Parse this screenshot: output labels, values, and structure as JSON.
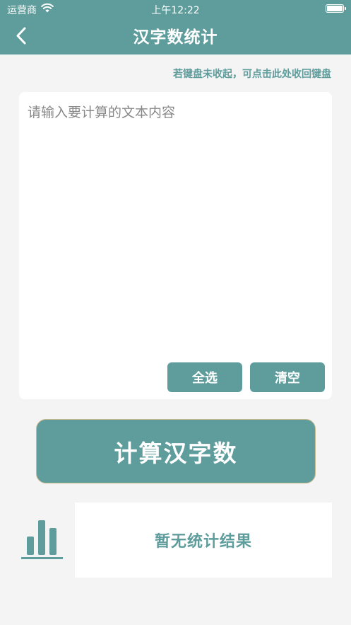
{
  "status_bar": {
    "carrier": "运营商",
    "time": "上午12:22"
  },
  "header": {
    "title": "汉字数统计",
    "back_icon": "chevron-left-icon"
  },
  "keyboard_hint": "若键盘未收起，可点击此处收回键盘",
  "input": {
    "placeholder": "请输入要计算的文本内容",
    "value": ""
  },
  "buttons": {
    "select_all": "全选",
    "clear": "清空",
    "calculate": "计算汉字数"
  },
  "result": {
    "icon": "bar-chart-icon",
    "text": "暂无统计结果"
  },
  "colors": {
    "accent": "#5f9d9d",
    "background": "#f4f4f4",
    "calc_border": "#c9b889"
  }
}
